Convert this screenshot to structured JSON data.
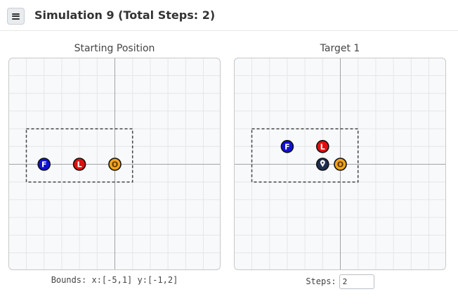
{
  "header": {
    "title": "Simulation 9 (Total Steps: 2)",
    "menu_icon": "hamburger-menu-icon"
  },
  "colors": {
    "follower": "#1010d8",
    "leader": "#e01010",
    "obstacle_or_target": "#f4a41a",
    "agent": "#1e2f4f",
    "gridline": "#e4e6e9",
    "axis": "#a0a4a8",
    "bounds_box": "#444444"
  },
  "panels": [
    {
      "title": "Starting Position",
      "x_range": [
        -6,
        6
      ],
      "y_range": [
        -6,
        6
      ],
      "bounds_rect": {
        "x": [
          -5,
          1
        ],
        "y": [
          -1,
          2
        ]
      },
      "pieces": [
        {
          "label": "F",
          "kind": "follower",
          "x": -4,
          "y": 0
        },
        {
          "label": "L",
          "kind": "leader",
          "x": -2,
          "y": 0
        },
        {
          "label": "O",
          "kind": "obstacle_or_target",
          "x": 0,
          "y": 0
        }
      ]
    },
    {
      "title": "Target 1",
      "x_range": [
        -6,
        6
      ],
      "y_range": [
        -6,
        6
      ],
      "bounds_rect": {
        "x": [
          -5,
          1
        ],
        "y": [
          -1,
          2
        ]
      },
      "pieces": [
        {
          "label": "F",
          "kind": "follower",
          "x": -3,
          "y": 1
        },
        {
          "label": "L",
          "kind": "leader",
          "x": -1,
          "y": 1
        },
        {
          "label": "",
          "kind": "agent",
          "x": -1,
          "y": 0,
          "icon": "location-pin-icon"
        },
        {
          "label": "O",
          "kind": "obstacle_or_target",
          "x": 0,
          "y": 0
        }
      ]
    }
  ],
  "footer": {
    "bounds_text": "Bounds: x:[-5,1] y:[-1,2]",
    "steps_label": "Steps:",
    "steps_value": "2"
  }
}
